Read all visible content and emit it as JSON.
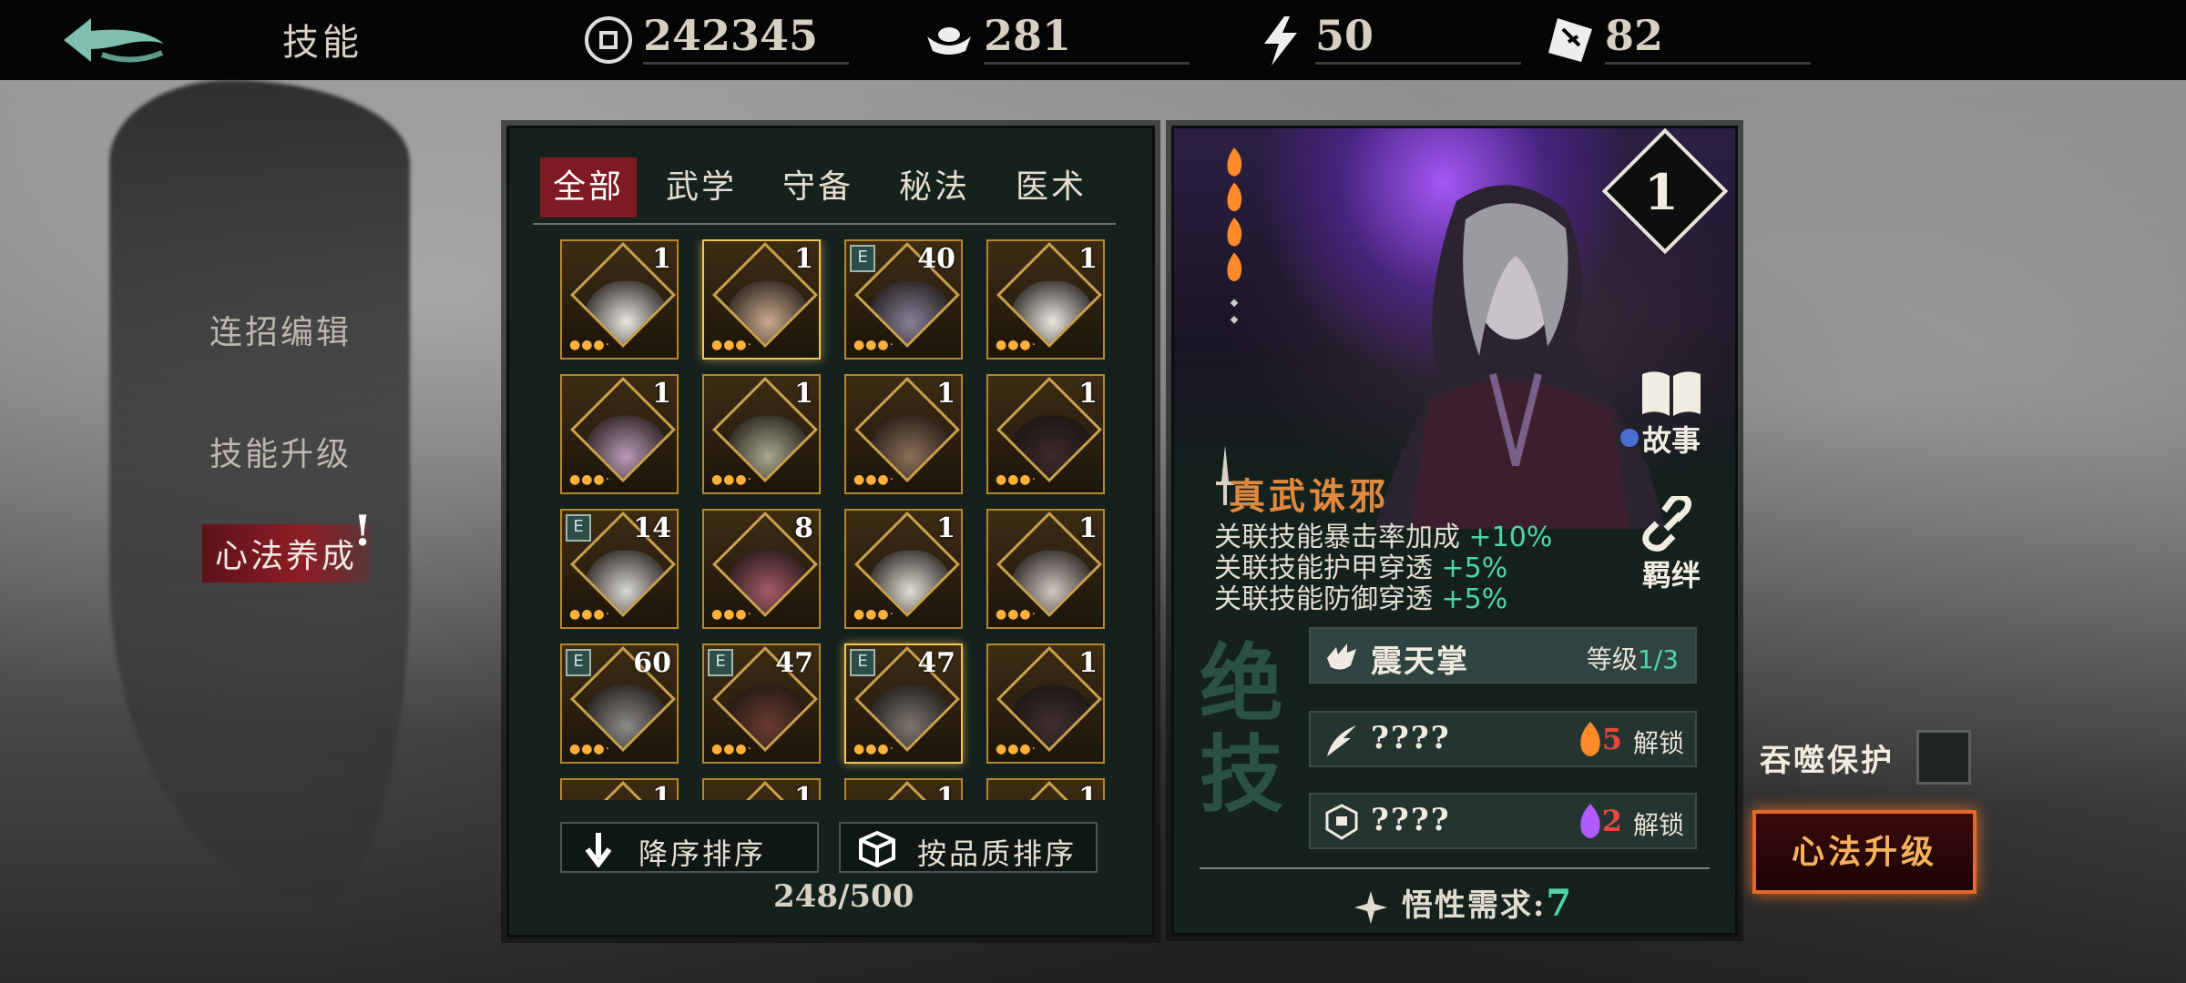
{
  "header": {
    "title": "技能",
    "resources": [
      {
        "icon": "coin-icon",
        "value": "242345"
      },
      {
        "icon": "silver-ingot-icon",
        "value": "281"
      },
      {
        "icon": "lightning-icon",
        "value": "50"
      },
      {
        "icon": "ticket-icon",
        "value": "82"
      }
    ]
  },
  "sidebar": {
    "items": [
      {
        "label": "连招编辑"
      },
      {
        "label": "技能升级"
      },
      {
        "label": "心法养成"
      }
    ],
    "alert": "!"
  },
  "library": {
    "tabs": [
      {
        "label": "全部"
      },
      {
        "label": "武学"
      },
      {
        "label": "守备"
      },
      {
        "label": "秘法"
      },
      {
        "label": "医术"
      }
    ],
    "cards": [
      {
        "level": "1",
        "e": "",
        "face": "#e9e6e0"
      },
      {
        "level": "1",
        "e": "",
        "face": "#c9a98d"
      },
      {
        "level": "40",
        "e": "E",
        "face": "#8a7f97"
      },
      {
        "level": "1",
        "e": "",
        "face": "#e9e6e0"
      },
      {
        "level": "1",
        "e": "",
        "face": "#b99ab6"
      },
      {
        "level": "1",
        "e": "",
        "face": "#a7a88c"
      },
      {
        "level": "1",
        "e": "",
        "face": "#8b6f57"
      },
      {
        "level": "1",
        "e": "",
        "face": "#3a2a2a"
      },
      {
        "level": "14",
        "e": "E",
        "face": "#d8d7d2"
      },
      {
        "level": "8",
        "e": "",
        "face": "#a4596a"
      },
      {
        "level": "1",
        "e": "",
        "face": "#e1ddd6"
      },
      {
        "level": "1",
        "e": "",
        "face": "#cfc7c2"
      },
      {
        "level": "60",
        "e": "E",
        "face": "#8b8a88"
      },
      {
        "level": "47",
        "e": "E",
        "face": "#6a3b30"
      },
      {
        "level": "47",
        "e": "E",
        "face": "#7c7570"
      },
      {
        "level": "1",
        "e": "",
        "face": "#3e2f2e"
      },
      {
        "level": "1",
        "e": "",
        "face": "#6b5a3a"
      },
      {
        "level": "1",
        "e": "",
        "face": "#6b5a3a"
      },
      {
        "level": "1",
        "e": "",
        "face": "#6b5a3a"
      },
      {
        "level": "1",
        "e": "",
        "face": "#4a2e66"
      }
    ],
    "sort_desc": "降序排序",
    "sort_quality": "按品质排序",
    "count": "248/500"
  },
  "detail": {
    "level": "1",
    "story": "故事",
    "bond": "羁绊",
    "skill_name": "真武诛邪",
    "bonuses": [
      {
        "text": "关联技能暴击率加成",
        "value": "+10%"
      },
      {
        "text": "关联技能护甲穿透",
        "value": "+5%"
      },
      {
        "text": "关联技能防御穿透",
        "value": "+5%"
      }
    ],
    "ultimate_label": "绝技",
    "skills": [
      {
        "name": "震天掌",
        "level_label": "等级",
        "level_value": "1/3"
      },
      {
        "name": "????",
        "req": "5",
        "unlock": "解锁",
        "gem": "#ff8a2a"
      },
      {
        "name": "????",
        "req": "2",
        "unlock": "解锁",
        "gem": "#b05aff"
      }
    ],
    "insight_label": "悟性需求:",
    "insight_value": "7"
  },
  "controls": {
    "protect_label": "吞噬保护",
    "upgrade_label": "心法升级"
  },
  "colors": {
    "accent_red": "#7d1a22",
    "teal": "#4fd6a8",
    "orange": "#e0893e"
  }
}
